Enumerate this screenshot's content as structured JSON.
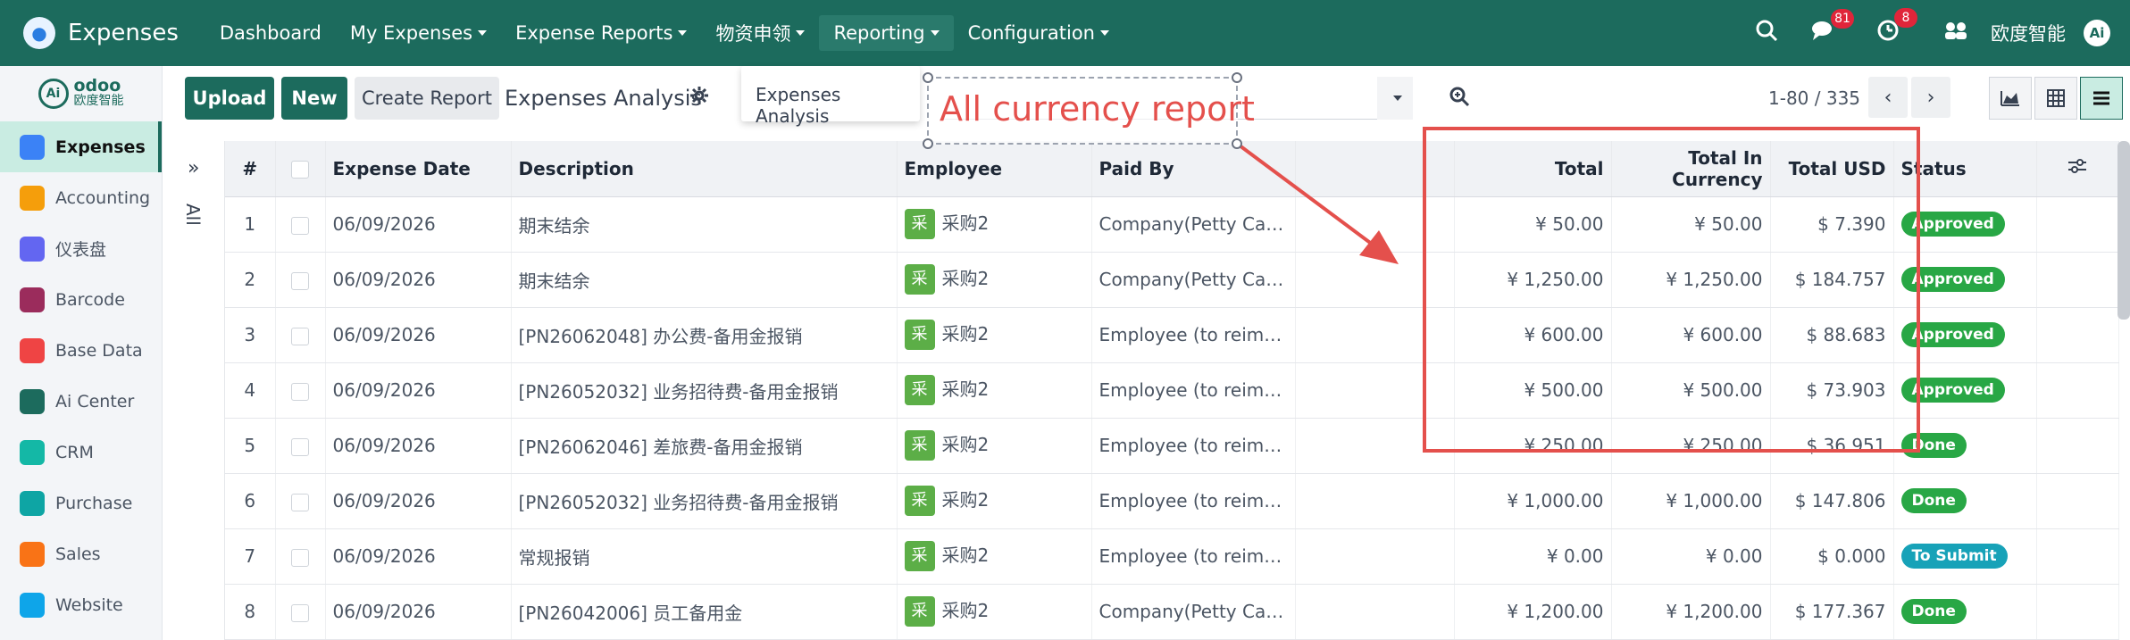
{
  "topbar": {
    "app_name": "Expenses",
    "menu": [
      {
        "label": "Dashboard",
        "caret": false
      },
      {
        "label": "My Expenses",
        "caret": true
      },
      {
        "label": "Expense Reports",
        "caret": true
      },
      {
        "label": "物资申领",
        "caret": true
      },
      {
        "label": "Reporting",
        "caret": true
      },
      {
        "label": "Configuration",
        "caret": true
      }
    ],
    "messages_count": "81",
    "activity_count": "8",
    "company": "欧度智能",
    "avatar": "Ai"
  },
  "sidebar": {
    "logo_word": "odoo",
    "logo_sub": "欧度智能",
    "logo_mark": "Ai",
    "items": [
      {
        "label": "Expenses",
        "icon": "expenses-icon",
        "color": "#3b82f6",
        "active": true
      },
      {
        "label": "Accounting",
        "icon": "accounting-icon",
        "color": "#f59e0b"
      },
      {
        "label": "仪表盘",
        "icon": "dashboard-icon",
        "color": "#6366f1"
      },
      {
        "label": "Barcode",
        "icon": "barcode-icon",
        "color": "#9b2c5c"
      },
      {
        "label": "Base Data",
        "icon": "base-data-icon",
        "color": "#ef4444"
      },
      {
        "label": "Ai Center",
        "icon": "ai-center-icon",
        "color": "#1c6b5d"
      },
      {
        "label": "CRM",
        "icon": "crm-icon",
        "color": "#14b8a6"
      },
      {
        "label": "Purchase",
        "icon": "purchase-icon",
        "color": "#0ea5a4"
      },
      {
        "label": "Sales",
        "icon": "sales-icon",
        "color": "#f97316"
      },
      {
        "label": "Website",
        "icon": "website-icon",
        "color": "#0ea5e9"
      }
    ]
  },
  "control": {
    "upload": "Upload",
    "new": "New",
    "create_report": "Create Report",
    "title": "Expenses Analysis",
    "pager": "1-80 / 335"
  },
  "dropdown": {
    "item": "Expenses Analysis"
  },
  "annotation": {
    "text": "All currency report"
  },
  "expander": {
    "label": "All"
  },
  "table": {
    "headers": [
      "#",
      "",
      "Expense Date",
      "Description",
      "Employee",
      "Paid By",
      "",
      "Total",
      "Total In Currency",
      "Total USD",
      "Status"
    ],
    "rows": [
      {
        "n": "1",
        "date": "06/09/2026",
        "desc": "期末结余",
        "emp_badge": "采",
        "emp": "采购2",
        "paid": "Company(Petty Cash)",
        "total": "¥ 50.00",
        "tic": "¥ 50.00",
        "usd": "$ 7.390",
        "status": "Approved",
        "cls": "approved"
      },
      {
        "n": "2",
        "date": "06/09/2026",
        "desc": "期末结余",
        "emp_badge": "采",
        "emp": "采购2",
        "paid": "Company(Petty Cash)",
        "total": "¥ 1,250.00",
        "tic": "¥ 1,250.00",
        "usd": "$ 184.757",
        "status": "Approved",
        "cls": "approved"
      },
      {
        "n": "3",
        "date": "06/09/2026",
        "desc": "[PN26062048] 办公费-备用金报销",
        "emp_badge": "采",
        "emp": "采购2",
        "paid": "Employee (to reimbur...",
        "total": "¥ 600.00",
        "tic": "¥ 600.00",
        "usd": "$ 88.683",
        "status": "Approved",
        "cls": "approved"
      },
      {
        "n": "4",
        "date": "06/09/2026",
        "desc": "[PN26052032] 业务招待费-备用金报销",
        "emp_badge": "采",
        "emp": "采购2",
        "paid": "Employee (to reimbur...",
        "total": "¥ 500.00",
        "tic": "¥ 500.00",
        "usd": "$ 73.903",
        "status": "Approved",
        "cls": "approved"
      },
      {
        "n": "5",
        "date": "06/09/2026",
        "desc": "[PN26062046] 差旅费-备用金报销",
        "emp_badge": "采",
        "emp": "采购2",
        "paid": "Employee (to reimbur...",
        "total": "¥ 250.00",
        "tic": "¥ 250.00",
        "usd": "$ 36.951",
        "status": "Done",
        "cls": "done"
      },
      {
        "n": "6",
        "date": "06/09/2026",
        "desc": "[PN26052032] 业务招待费-备用金报销",
        "emp_badge": "采",
        "emp": "采购2",
        "paid": "Employee (to reimbur...",
        "total": "¥ 1,000.00",
        "tic": "¥ 1,000.00",
        "usd": "$ 147.806",
        "status": "Done",
        "cls": "done"
      },
      {
        "n": "7",
        "date": "06/09/2026",
        "desc": "常规报销",
        "emp_badge": "采",
        "emp": "采购2",
        "paid": "Employee (to reimbur...",
        "total": "¥ 0.00",
        "tic": "¥ 0.00",
        "usd": "$ 0.000",
        "status": "To Submit",
        "cls": "tosubmit"
      },
      {
        "n": "8",
        "date": "06/09/2026",
        "desc": "[PN26042006] 员工备用金",
        "emp_badge": "采",
        "emp": "采购2",
        "paid": "Company(Petty Cash)",
        "total": "¥ 1,200.00",
        "tic": "¥ 1,200.00",
        "usd": "$ 177.367",
        "status": "Done",
        "cls": "done"
      }
    ]
  }
}
